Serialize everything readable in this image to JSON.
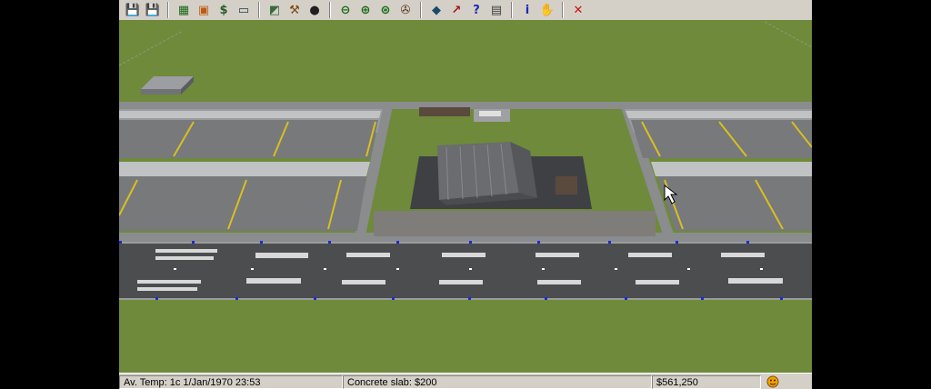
{
  "toolbar": {
    "buttons": [
      {
        "name": "save-game-icon",
        "glyph": "💾",
        "color": "#1a3c9a"
      },
      {
        "name": "save-as-icon",
        "glyph": "💾",
        "color": "#9a1a1a"
      },
      {
        "name": "build-menu-icon",
        "glyph": "▦",
        "color": "#1a6a1a"
      },
      {
        "name": "finance-icon",
        "glyph": "▣",
        "color": "#c05a10"
      },
      {
        "name": "money-icon",
        "glyph": "$",
        "color": "#2a5a2a"
      },
      {
        "name": "computer-icon",
        "glyph": "▭",
        "color": "#204040"
      },
      {
        "name": "build-tool-icon",
        "glyph": "◩",
        "color": "#3a6a3a"
      },
      {
        "name": "bulldoze-icon",
        "glyph": "⚒",
        "color": "#7a4a10"
      },
      {
        "name": "vehicle-icon",
        "glyph": "●",
        "color": "#202020"
      },
      {
        "name": "zoom-out-icon",
        "glyph": "⊖",
        "color": "#1a6a1a"
      },
      {
        "name": "zoom-in-icon",
        "glyph": "⊕",
        "color": "#1a6a1a"
      },
      {
        "name": "zoom-reset-icon",
        "glyph": "⊛",
        "color": "#1a6a1a"
      },
      {
        "name": "camera-icon",
        "glyph": "✇",
        "color": "#5a3a20"
      },
      {
        "name": "terrain-view-icon",
        "glyph": "◆",
        "color": "#1a4a6a"
      },
      {
        "name": "graph-icon",
        "glyph": "↗",
        "color": "#a01a1a"
      },
      {
        "name": "help-icon",
        "glyph": "?",
        "color": "#1a2ab0"
      },
      {
        "name": "report-icon",
        "glyph": "▤",
        "color": "#404040"
      },
      {
        "name": "info-icon",
        "glyph": "i",
        "color": "#1a2ab0"
      },
      {
        "name": "hand-icon",
        "glyph": "✋",
        "color": "#c8a070"
      },
      {
        "name": "close-icon",
        "glyph": "✕",
        "color": "#d01010"
      }
    ]
  },
  "status": {
    "temp_date": "Av. Temp: 1c  1/Jan/1970 23:53",
    "tool": "Concrete slab: $200",
    "empty": "",
    "money": "$561,250",
    "mood_icon": "smiley-icon"
  },
  "colors": {
    "grass": "#6e8a3a",
    "taxiway": "#8a8c8e",
    "stand": "#77797b",
    "runway": "#4c4d4f",
    "line_yellow": "#d8c020",
    "edge_light": "#1a2ad8"
  }
}
